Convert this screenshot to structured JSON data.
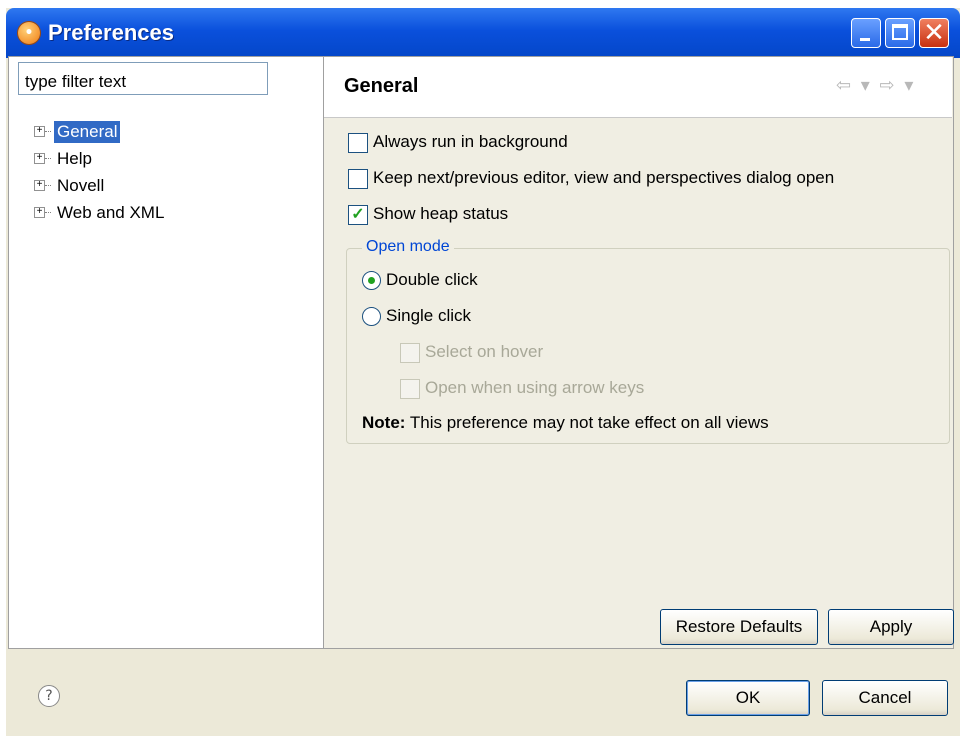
{
  "window": {
    "title": "Preferences",
    "title_icon": "eclipse-icon",
    "minimize_icon": "minimize-icon",
    "maximize_icon": "maximize-icon",
    "close_label": "✕"
  },
  "sidebar": {
    "filter": {
      "value": "type filter text",
      "placeholder": "type filter text"
    },
    "items": [
      {
        "label": "General",
        "selected": true,
        "expander": "+"
      },
      {
        "label": "Help",
        "selected": false,
        "expander": "+"
      },
      {
        "label": "Novell",
        "selected": false,
        "expander": "+"
      },
      {
        "label": "Web and XML",
        "selected": false,
        "expander": "+"
      }
    ]
  },
  "main": {
    "title": "General",
    "nav": {
      "back_icon": "back-arrow-icon",
      "forward_icon": "forward-arrow-icon",
      "glyphs": "⇦ ▾ ⇨ ▾"
    },
    "options": [
      {
        "label": "Always run in background",
        "checked": false,
        "mark": ""
      },
      {
        "label": "Keep next/previous editor, view and perspectives dialog open",
        "checked": false,
        "mark": ""
      },
      {
        "label": "Show heap status",
        "checked": true,
        "mark": "✓"
      }
    ],
    "open_mode": {
      "legend": "Open mode",
      "radios": [
        {
          "label": "Double click",
          "selected": true
        },
        {
          "label": "Single click",
          "selected": false
        }
      ],
      "sub_options": [
        {
          "label": "Select on hover",
          "checked": false,
          "enabled": false
        },
        {
          "label": "Open when using arrow keys",
          "checked": false,
          "enabled": false
        }
      ],
      "note_prefix": "Note:",
      "note_text": "This preference may not take effect on all views"
    },
    "buttons": {
      "restore_defaults": "Restore Defaults",
      "apply": "Apply"
    }
  },
  "footer": {
    "help_icon": "help-icon",
    "help_glyph": "?",
    "ok": "OK",
    "cancel": "Cancel"
  },
  "colors": {
    "titlebar": "#0a50dc",
    "selection": "#316ac5",
    "check": "#21a121",
    "group_legend": "#0046d5"
  }
}
